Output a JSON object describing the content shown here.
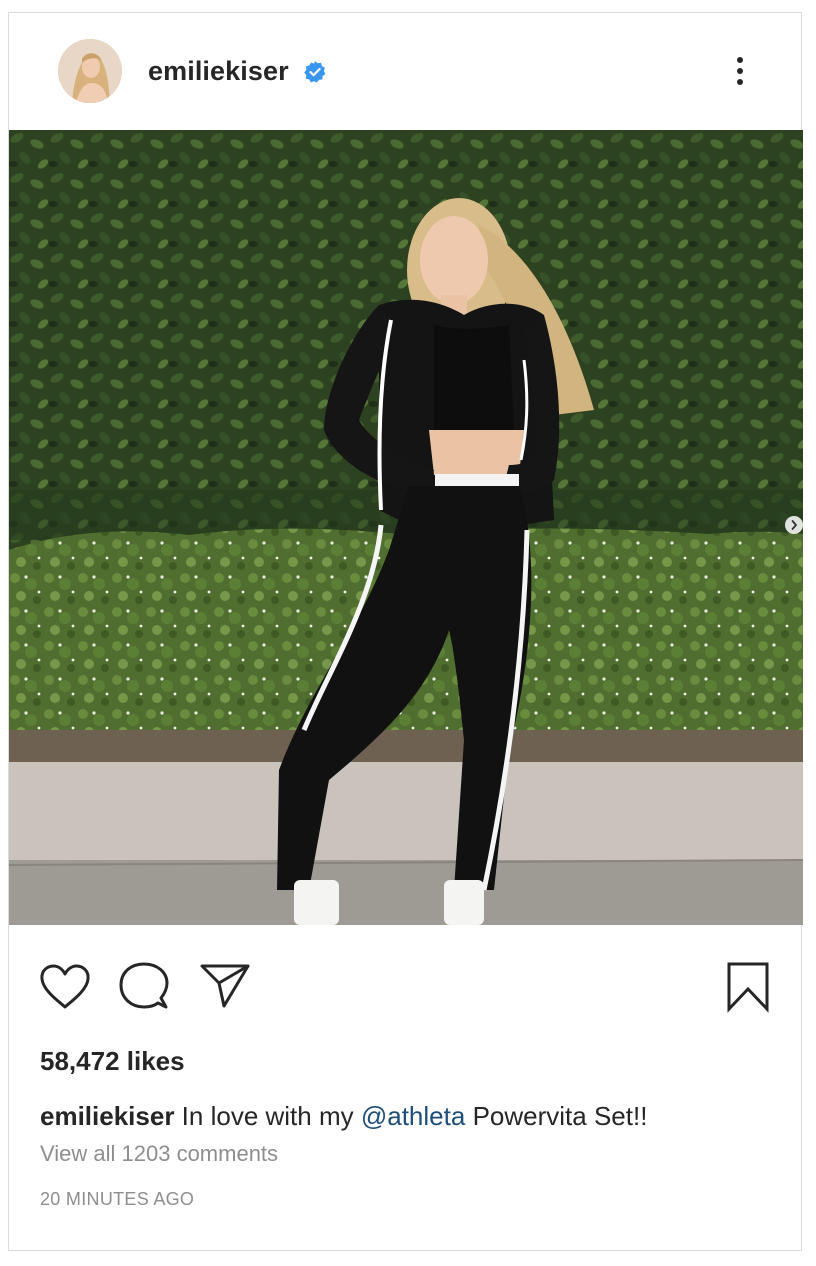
{
  "post": {
    "username": "emiliekiser",
    "verified": true,
    "likes_text": "58,472 likes",
    "caption": {
      "username": "emiliekiser",
      "text_before": "In love with my",
      "mention": "@athleta",
      "text_after": "Powervita Set!!"
    },
    "view_comments": "View all 1203 comments",
    "timestamp": "20 MINUTES AGO"
  },
  "colors": {
    "verified_blue": "#3897f0",
    "mention": "#1f4e79",
    "muted": "#8e8e8e",
    "border": "#dbdbdb"
  },
  "icons": [
    "avatar",
    "verified-badge-icon",
    "more-options-icon",
    "next-image-icon",
    "heart-icon",
    "comment-icon",
    "share-icon",
    "bookmark-icon"
  ]
}
